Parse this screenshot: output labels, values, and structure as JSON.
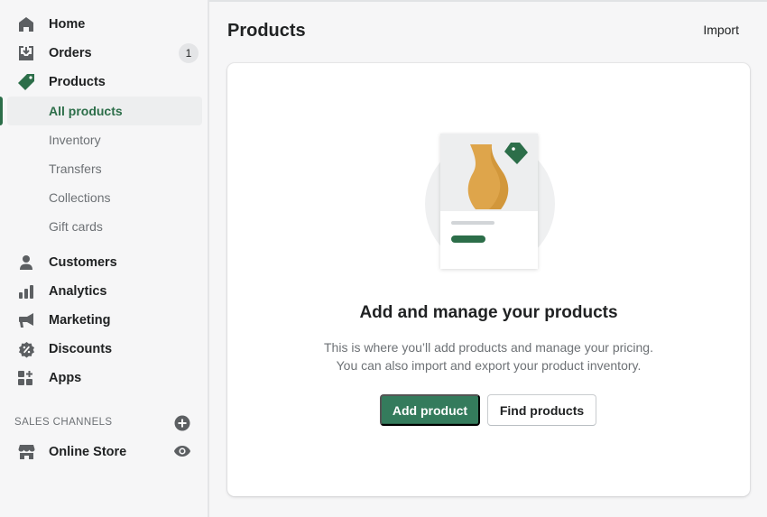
{
  "sidebar": {
    "nav": [
      {
        "label": "Home",
        "icon": "home-icon"
      },
      {
        "label": "Orders",
        "icon": "orders-icon",
        "badge": "1"
      },
      {
        "label": "Products",
        "icon": "tag-icon"
      }
    ],
    "products_sub": [
      {
        "label": "All products",
        "active": true
      },
      {
        "label": "Inventory"
      },
      {
        "label": "Transfers"
      },
      {
        "label": "Collections"
      },
      {
        "label": "Gift cards"
      }
    ],
    "nav2": [
      {
        "label": "Customers",
        "icon": "customer-icon"
      },
      {
        "label": "Analytics",
        "icon": "analytics-icon"
      },
      {
        "label": "Marketing",
        "icon": "megaphone-icon"
      },
      {
        "label": "Discounts",
        "icon": "discount-icon"
      },
      {
        "label": "Apps",
        "icon": "apps-icon"
      }
    ],
    "sales_channels": {
      "title": "SALES CHANNELS",
      "items": [
        {
          "label": "Online Store",
          "icon": "store-icon"
        }
      ]
    }
  },
  "header": {
    "title": "Products",
    "import_label": "Import"
  },
  "empty_state": {
    "title": "Add and manage your products",
    "description_line1": "This is where you’ll add products and manage your pricing.",
    "description_line2": "You can also import and export your product inventory.",
    "primary_action": "Add product",
    "secondary_action": "Find products"
  },
  "colors": {
    "accent": "#2c6e49",
    "button_primary": "#347b5c",
    "icon": "#5c5f62",
    "illustration_vase": "#dea54b"
  }
}
